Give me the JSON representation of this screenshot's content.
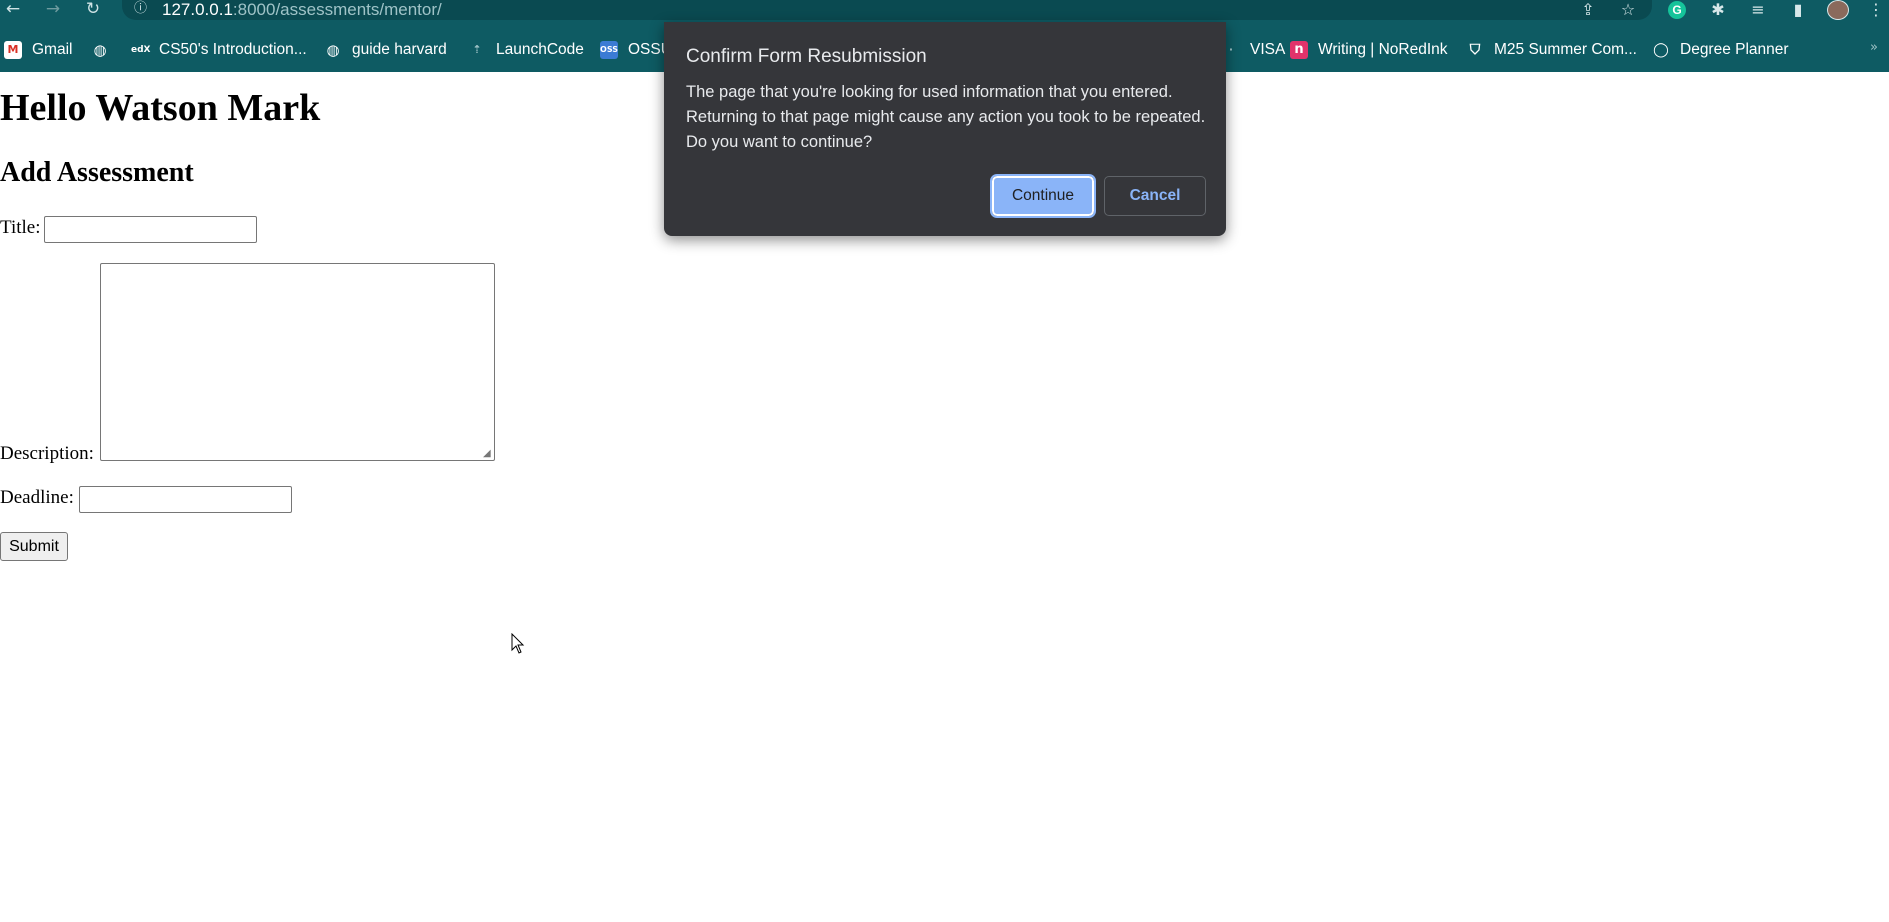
{
  "browser": {
    "url_host": "127.0.0.1",
    "url_path": ":8000/assessments/mentor/",
    "back_icon": "back-arrow-icon",
    "forward_icon": "forward-arrow-icon",
    "reload_icon": "reload-icon",
    "site_info_icon": "info-icon",
    "bookmarks": [
      {
        "label": "Gmail",
        "icon": "gmail-icon"
      },
      {
        "label": "CS50's Introduction...",
        "icon": "edx-icon"
      },
      {
        "label": "guide harvard",
        "icon": "globe-icon"
      },
      {
        "label": "LaunchCode",
        "icon": "launchcode-icon"
      },
      {
        "label": "OSSU",
        "icon": "ossu-icon"
      },
      {
        "label": "VISA",
        "icon": "visa-icon"
      },
      {
        "label": "Writing | NoRedInk",
        "icon": "noredink-icon"
      },
      {
        "label": "M25 Summer Com...",
        "icon": "shield-icon"
      },
      {
        "label": "Degree Planner",
        "icon": "circle-icon"
      }
    ],
    "colors": {
      "chrome": "#0e5b63",
      "dialog": "#35363a",
      "accent": "#8ab4f8"
    }
  },
  "page": {
    "greeting": "Hello Watson Mark",
    "form_heading": "Add Assessment",
    "title_label": "Title:",
    "description_label": "Description:",
    "deadline_label": "Deadline:",
    "title_value": "",
    "description_value": "",
    "deadline_value": "",
    "submit_label": "Submit"
  },
  "dialog": {
    "title": "Confirm Form Resubmission",
    "lines": [
      "The page that you're looking for used information that you entered.",
      "Returning to that page might cause any action you took to be repeated.",
      "Do you want to continue?"
    ],
    "continue_label": "Continue",
    "cancel_label": "Cancel"
  }
}
